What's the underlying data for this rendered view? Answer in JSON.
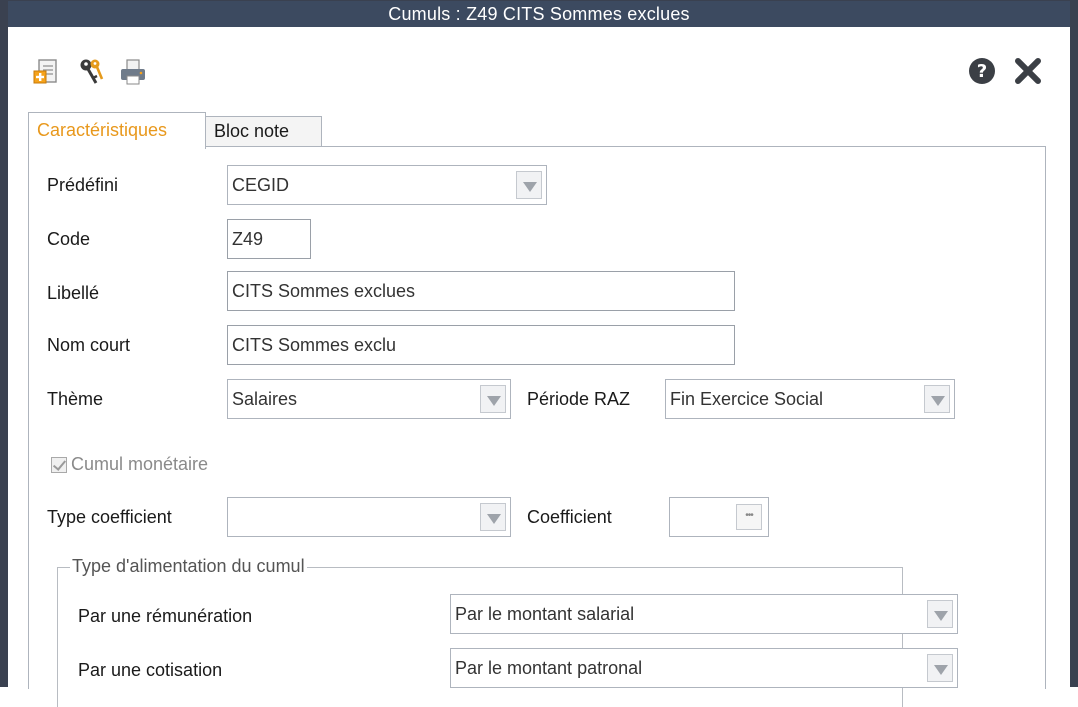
{
  "window": {
    "title": "Cumuls  : Z49 CITS Sommes exclues"
  },
  "toolbar": {
    "icons": [
      "new-document-icon",
      "keys-icon",
      "printer-icon"
    ],
    "help_icon": "help-circle-icon",
    "close_icon": "close-x-icon"
  },
  "tabs": [
    {
      "label": "Caractéristiques",
      "active": true
    },
    {
      "label": "Bloc note",
      "active": false
    }
  ],
  "form": {
    "predefini": {
      "label": "Prédéfini",
      "value": "CEGID"
    },
    "code": {
      "label": "Code",
      "value": "Z49"
    },
    "libelle": {
      "label": "Libellé",
      "value": "CITS Sommes exclues"
    },
    "nom_court": {
      "label": "Nom court",
      "value": "CITS Sommes exclu"
    },
    "theme": {
      "label": "Thème",
      "value": "Salaires"
    },
    "periode_raz": {
      "label": "Période RAZ",
      "value": "Fin Exercice Social"
    },
    "cumul_monetaire": {
      "label": "Cumul monétaire",
      "checked": true,
      "disabled": true
    },
    "type_coefficient": {
      "label": "Type coefficient",
      "value": ""
    },
    "coefficient": {
      "label": "Coefficient",
      "value": ""
    }
  },
  "alimentation": {
    "legend": "Type d'alimentation du cumul",
    "remuneration": {
      "label": "Par une rémunération",
      "value": "Par le montant salarial"
    },
    "cotisation": {
      "label": "Par une cotisation",
      "value": "Par le montant patronal"
    }
  },
  "colors": {
    "titlebar": "#3c4a60",
    "active_tab": "#e8981c",
    "border": "#aeb4bd"
  }
}
